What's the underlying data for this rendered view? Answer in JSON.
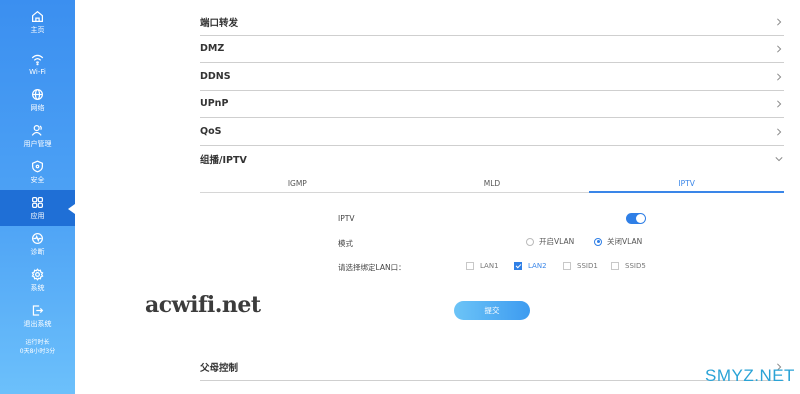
{
  "sidebar": {
    "items": [
      {
        "label": "主页",
        "icon": "home-icon"
      },
      {
        "label": "Wi-Fi",
        "icon": "wifi-icon"
      },
      {
        "label": "网络",
        "icon": "globe-icon"
      },
      {
        "label": "用户管理",
        "icon": "users-icon"
      },
      {
        "label": "安全",
        "icon": "shield-icon"
      },
      {
        "label": "应用",
        "icon": "apps-icon"
      },
      {
        "label": "诊断",
        "icon": "diagnose-icon"
      },
      {
        "label": "系统",
        "icon": "gear-icon"
      },
      {
        "label": "退出系统",
        "icon": "logout-icon"
      }
    ],
    "active_index": 5,
    "uptime_label": "运行时长",
    "uptime_value": "0天8小时3分"
  },
  "sections": {
    "port_forward": "端口转发",
    "dmz": "DMZ",
    "ddns": "DDNS",
    "upnp": "UPnP",
    "qos": "QoS",
    "multicast_iptv": "组播/IPTV",
    "parental_control": "父母控制"
  },
  "tabs": [
    "IGMP",
    "MLD",
    "IPTV"
  ],
  "active_tab": "IPTV",
  "form": {
    "iptv_label": "IPTV",
    "iptv_enabled": true,
    "mode_label": "模式",
    "mode_options": [
      "开启VLAN",
      "关闭VLAN"
    ],
    "mode_selected": "关闭VLAN",
    "lan_label": "请选择绑定LAN口：",
    "lan_ports": [
      {
        "label": "LAN1",
        "checked": false
      },
      {
        "label": "LAN2",
        "checked": true
      },
      {
        "label": "SSID1",
        "checked": false
      },
      {
        "label": "SSID5",
        "checked": false
      }
    ],
    "submit_label": "提交"
  },
  "watermarks": {
    "left": "acwifi.net",
    "right": "SMYZ.NET"
  },
  "colors": {
    "accent": "#2f7fe6",
    "sidebar_top": "#3b8ff0",
    "sidebar_bottom": "#6cc0fb",
    "sidebar_active": "#1f6fd6"
  }
}
